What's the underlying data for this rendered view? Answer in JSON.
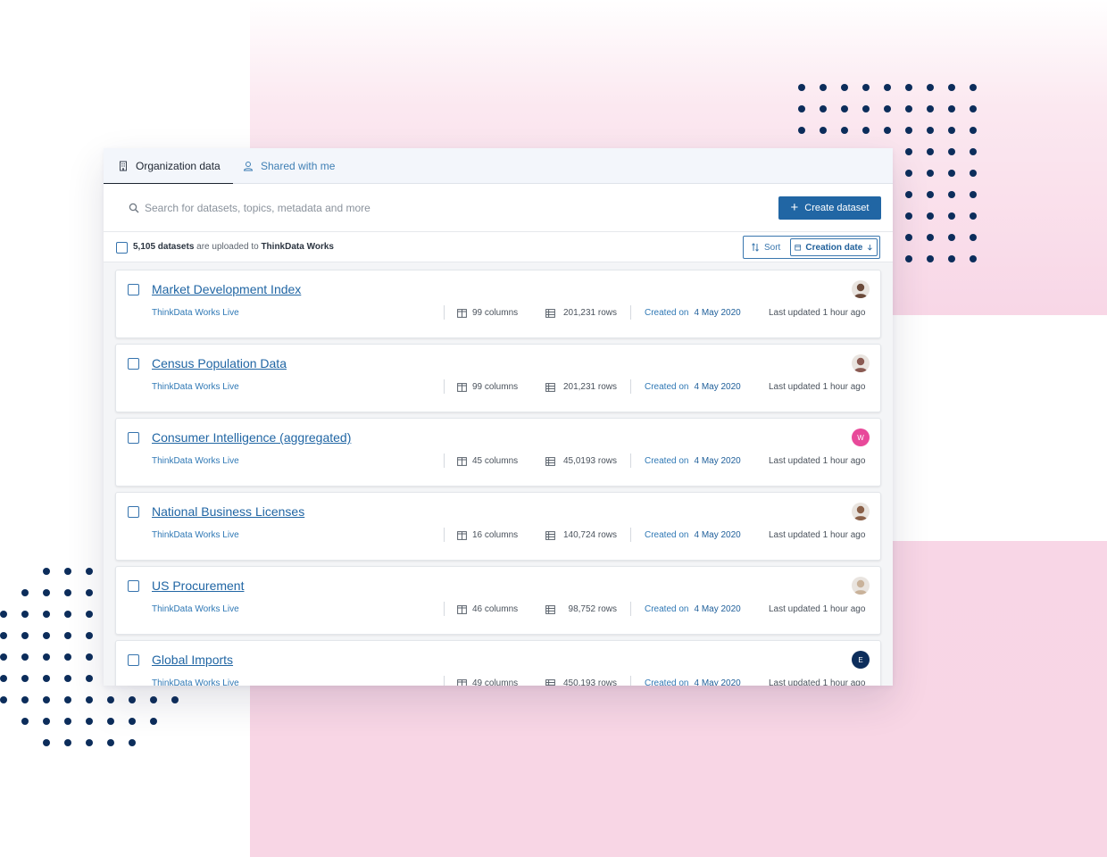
{
  "tabs": [
    {
      "label": "Organization data",
      "icon": "building-icon",
      "active": true
    },
    {
      "label": "Shared with me",
      "icon": "user-icon",
      "active": false
    }
  ],
  "search": {
    "placeholder": "Search for datasets, topics, metadata and more",
    "value": ""
  },
  "create_button": {
    "label": "Create dataset",
    "icon": "plus-icon"
  },
  "summary": {
    "count": "5,105 datasets",
    "middle": " are uploaded to ",
    "org": "ThinkData Works"
  },
  "sort": {
    "label": "Sort",
    "icon": "sort-arrows-icon",
    "value": "Creation date",
    "value_icon": "calendar-icon",
    "direction_icon": "arrow-down-icon"
  },
  "colors": {
    "accent": "#2166a4",
    "link": "#2f78b5",
    "dots": "#0c2d5b",
    "pink_bg": "#f8d6e5"
  },
  "datasets": [
    {
      "title": "Market Development Index",
      "source": "ThinkData Works Live",
      "columns": "99 columns",
      "rows": "201,231 rows",
      "created_label": "Created on",
      "created_date": "4 May 2020",
      "updated": "Last updated 1 hour ago",
      "avatar": {
        "type": "photo",
        "initial": "",
        "color": "#6b4a3a"
      }
    },
    {
      "title": "Census Population Data",
      "source": "ThinkData Works Live",
      "columns": "99 columns",
      "rows": "201,231 rows",
      "created_label": "Created on",
      "created_date": "4 May 2020",
      "updated": "Last updated 1 hour ago",
      "avatar": {
        "type": "photo",
        "initial": "",
        "color": "#8a5a52"
      }
    },
    {
      "title": "Consumer Intelligence (aggregated)",
      "source": "ThinkData Works Live",
      "columns": "45 columns",
      "rows": "45,0193 rows",
      "created_label": "Created on",
      "created_date": "4 May 2020",
      "updated": "Last updated 1 hour ago",
      "avatar": {
        "type": "initial",
        "initial": "W",
        "color": "#e8499a"
      }
    },
    {
      "title": "National Business Licenses",
      "source": "ThinkData Works Live",
      "columns": "16 columns",
      "rows": "140,724 rows",
      "created_label": "Created on",
      "created_date": "4 May 2020",
      "updated": "Last updated 1 hour ago",
      "avatar": {
        "type": "photo",
        "initial": "",
        "color": "#8a6048"
      }
    },
    {
      "title": "US Procurement",
      "source": "ThinkData Works Live",
      "columns": "46 columns",
      "rows": "98,752 rows",
      "created_label": "Created on",
      "created_date": "4 May 2020",
      "updated": "Last updated 1 hour ago",
      "avatar": {
        "type": "photo",
        "initial": "",
        "color": "#c9b29a"
      }
    },
    {
      "title": "Global Imports",
      "source": "ThinkData Works Live",
      "columns": "49 columns",
      "rows": "450,193 rows",
      "created_label": "Created on",
      "created_date": "4 May 2020",
      "updated": "Last updated 1 hour ago",
      "avatar": {
        "type": "initial",
        "initial": "E",
        "color": "#0c2d5b"
      }
    }
  ]
}
